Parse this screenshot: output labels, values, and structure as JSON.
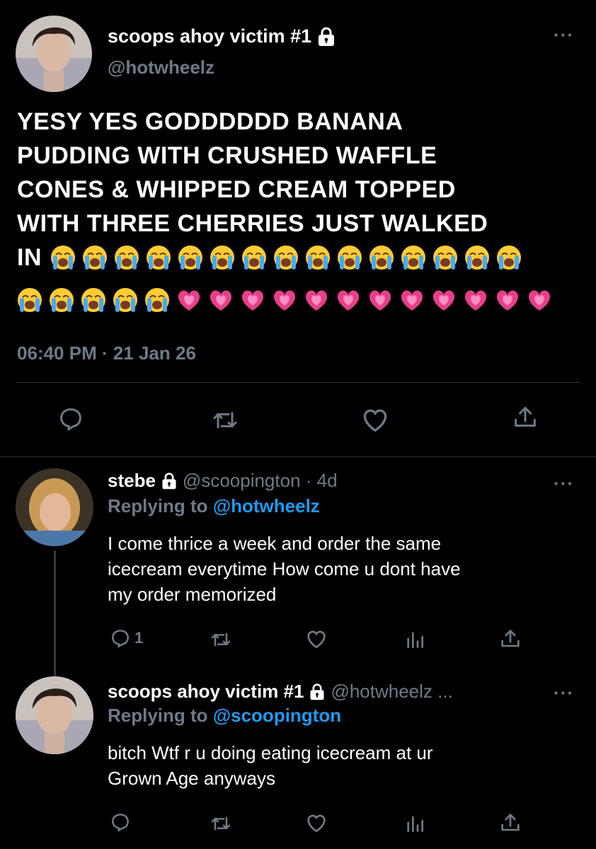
{
  "main_tweet": {
    "display_name": "scoops ahoy victim #1",
    "handle": "@hotwheelz",
    "text_line_1": "YESY YES GODDDDDD BANANA",
    "text_line_2": "PUDDING WITH CRUSHED WAFFLE",
    "text_line_3": "CONES & WHIPPED CREAM TOPPED",
    "text_line_4": "WITH THREE CHERRIES JUST WALKED",
    "text_line_5": "IN",
    "crying_emoji_line_5": 15,
    "crying_emoji_line_6": 5,
    "heart_emoji_line_6": 12,
    "timestamp": "06:40 PM · 21 Jan 26",
    "actions": [
      "reply-icon",
      "retweet-icon",
      "like-icon",
      "share-icon"
    ]
  },
  "reply_1": {
    "display_name": "stebe",
    "handle_time": "@scoopington · 4d",
    "replying_prefix": "Replying to ",
    "replying_to": "@hotwheelz",
    "text_line_1": "I come thrice a week and order the same",
    "text_line_2": "icecream  everytime How come  u dont have",
    "text_line_3": "my order memorized",
    "reply_count": "1"
  },
  "reply_2": {
    "display_name": "scoops ahoy victim #1",
    "handle_time": "@hotwheelz ...",
    "replying_prefix": "Replying to ",
    "replying_to": "@scoopington",
    "text_line_1": "bitch  Wtf r u doing eating icecream at ur",
    "text_line_2": "Grown Age  anyways"
  },
  "colors": {
    "background": "#000000",
    "muted": "#6e7a86",
    "link": "#1d9bf0",
    "heart_emoji": "#e83e8c"
  }
}
